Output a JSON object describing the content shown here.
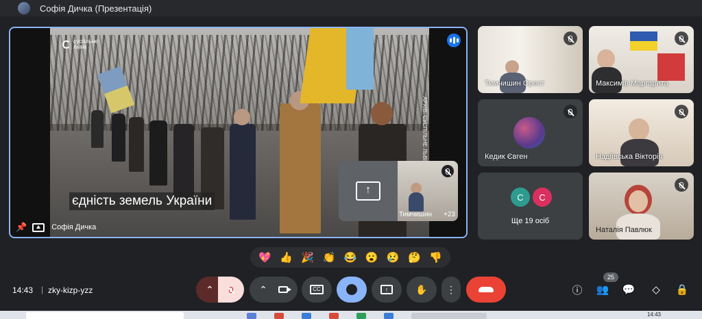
{
  "topbar": {
    "title": "Софія Дичка (Презентація)"
  },
  "main": {
    "brand": "суспільне\nльвів",
    "archive_label": "АРХІВ: СУСПІЛЬНЕ ЛЬВІВ",
    "caption": "єдність земель України",
    "presenter": "Софія Дичка"
  },
  "self_tile": {
    "name": "Тимчишин",
    "more": "+23"
  },
  "participants": [
    {
      "name": "Тимчишин Орест"
    },
    {
      "name": "Максимів Маргарита"
    },
    {
      "name": "Кедик Євген"
    },
    {
      "name": "Надіївська Вікторія"
    },
    {
      "initials": [
        "С",
        "С"
      ],
      "more_label": "Ще 19 осіб"
    },
    {
      "name": "Наталія Павлюк"
    }
  ],
  "reactions": [
    "💖",
    "👍",
    "🎉",
    "👏",
    "😂",
    "😮",
    "😢",
    "🤔",
    "👎"
  ],
  "bottom": {
    "time": "14:43",
    "separator": "|",
    "meeting_code": "zky-kizp-yzz",
    "people_count": "25"
  },
  "taskbar": {
    "clock": "14:43"
  },
  "colors": {
    "accent": "#8ab4f8",
    "end_call": "#ea4335",
    "avatar_c1": "#2e9b8f",
    "avatar_c2": "#d93060"
  }
}
